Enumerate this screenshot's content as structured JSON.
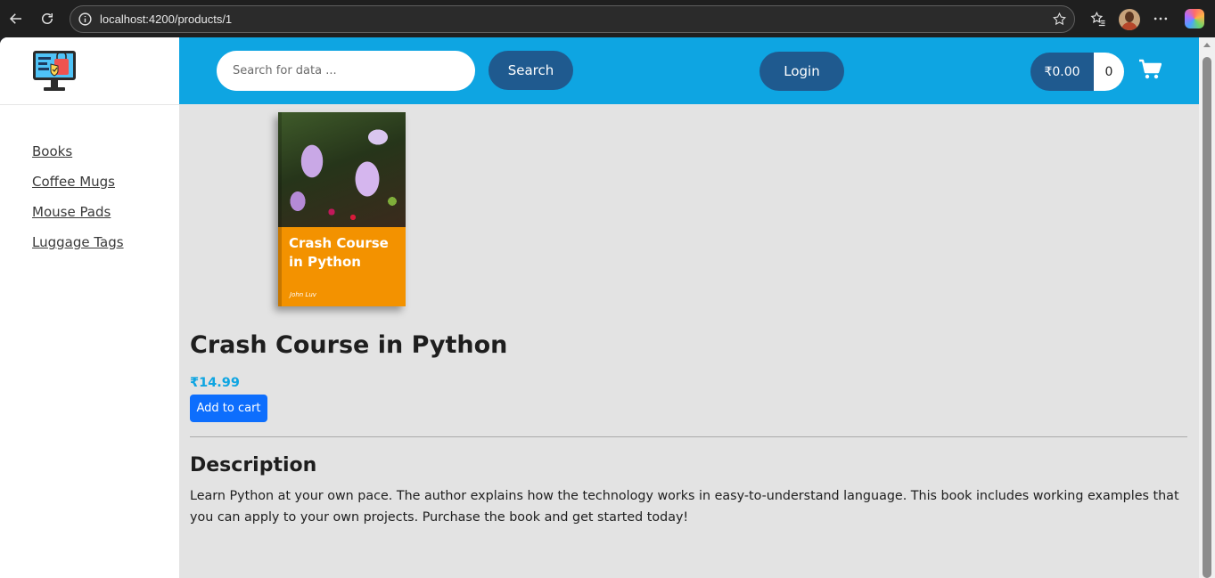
{
  "browser": {
    "url": "localhost:4200/products/1"
  },
  "search": {
    "placeholder": "Search for data ...",
    "button_label": "Search"
  },
  "header": {
    "login_label": "Login",
    "cart_total": "₹0.00",
    "cart_count": "0"
  },
  "sidebar": {
    "items": [
      {
        "label": "Books"
      },
      {
        "label": "Coffee Mugs"
      },
      {
        "label": "Mouse Pads"
      },
      {
        "label": "Luggage Tags"
      }
    ]
  },
  "product": {
    "cover_title": "Crash Course in Python",
    "cover_author": "John Luv",
    "name": "Crash Course in Python",
    "price": "₹14.99",
    "add_to_cart_label": "Add to cart",
    "description_heading": "Description",
    "description": "Learn Python at your own pace. The author explains how the technology works in easy-to-understand language. This book includes working examples that you can apply to your own projects. Purchase the book and get started today!"
  },
  "colors": {
    "header_bg": "#0ea5e2",
    "button_dark": "#1f5a8f",
    "price": "#0ea5e2",
    "primary_button": "#0d6efd",
    "content_bg": "#e3e3e3"
  }
}
